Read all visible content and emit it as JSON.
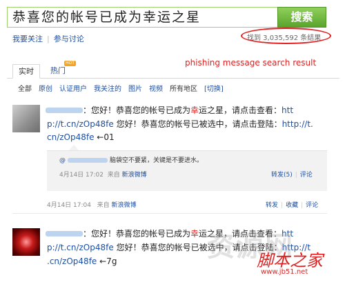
{
  "search": {
    "query": "恭喜您的帐号已成为幸运之星",
    "button_label": "搜索",
    "result_count": "找到 3,035,592 条结果"
  },
  "top_links": [
    "我要关注",
    "参与讨论"
  ],
  "annotation": "phishing message search result",
  "tabs": [
    {
      "label": "实时"
    },
    {
      "label": "热门",
      "badge": "HOT"
    }
  ],
  "filters": [
    "全部",
    "原创",
    "认证用户",
    "我关注的",
    "图片",
    "视频",
    "所有地区",
    "[切换]"
  ],
  "posts": [
    {
      "line1_a": "：您好！恭喜您的帐号已成为",
      "line1_red": "幸",
      "line1_b": "运之星，请点击查看：",
      "line1_link": "htt",
      "line2_link": "p://t.cn/zOp48fe",
      "line2_text": " 您好！恭喜您的帐号已被选中，请点击登陆：",
      "line2_link2": "http://t.",
      "line3_link": "cn/zOp48fe",
      "line3_text": " ←01",
      "quote": {
        "author": "@",
        "text": "脑袋空不要紧，关键是不要进水。",
        "date": "4月14日 17:02",
        "source_prefix": "来自",
        "source": "新浪微博",
        "actions": [
          "转发(5)",
          "评论"
        ]
      },
      "date": "4月14日 17:04",
      "source_prefix": "来自",
      "source": "新浪微博",
      "actions": [
        "转发",
        "收藏",
        "评论"
      ]
    },
    {
      "line1_a": "：您好！恭喜您的帐号已成为",
      "line1_red": "幸",
      "line1_b": "运之星，请点击查看：",
      "line1_link": "htt",
      "line2_link": "p://t.cn/zOp48fe",
      "line2_text": " 您好！恭喜您的帐号已被选中，请点击登陆：",
      "line2_link2": "http://t",
      "line3_link": ".cn/zOp48fe",
      "line3_text": " ←7g"
    }
  ],
  "watermark": {
    "big": "资源网",
    "brand": "脚本之家",
    "url": "www.jb51.net"
  },
  "colors": {
    "accent_green": "#6ab63b",
    "link_blue": "#1f4fa0",
    "annotation_red": "#e02020"
  }
}
